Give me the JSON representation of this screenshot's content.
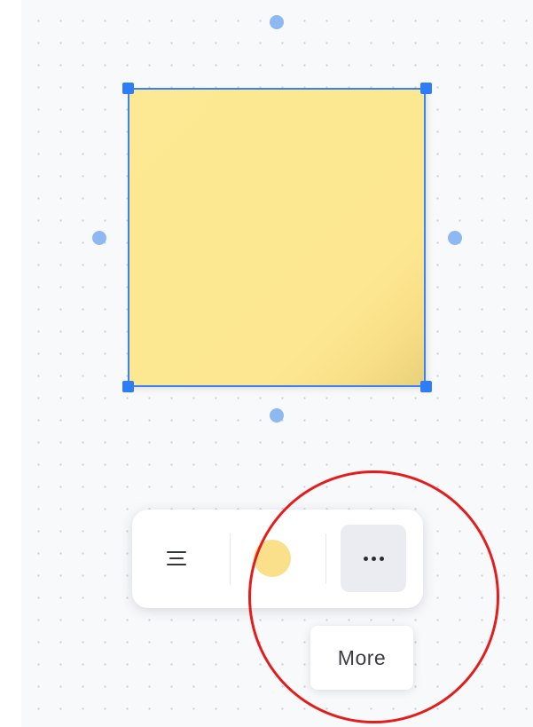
{
  "canvas": {
    "background_color": "#f8f9fb",
    "grid_dot_color": "#c9ced6"
  },
  "sticky_note": {
    "fill_color": "#fde891",
    "selected": true,
    "selection_color": "#3b82f6"
  },
  "toolbar": {
    "buttons": [
      {
        "name": "text-align",
        "icon": "align-center-icon"
      },
      {
        "name": "note-color",
        "icon": "color-swatch",
        "color": "#fbe08c"
      },
      {
        "name": "more",
        "icon": "more-horizontal-icon",
        "active": true
      }
    ]
  },
  "tooltip": {
    "text": "More"
  },
  "annotation": {
    "shape": "circle",
    "color": "#e41c1c"
  }
}
